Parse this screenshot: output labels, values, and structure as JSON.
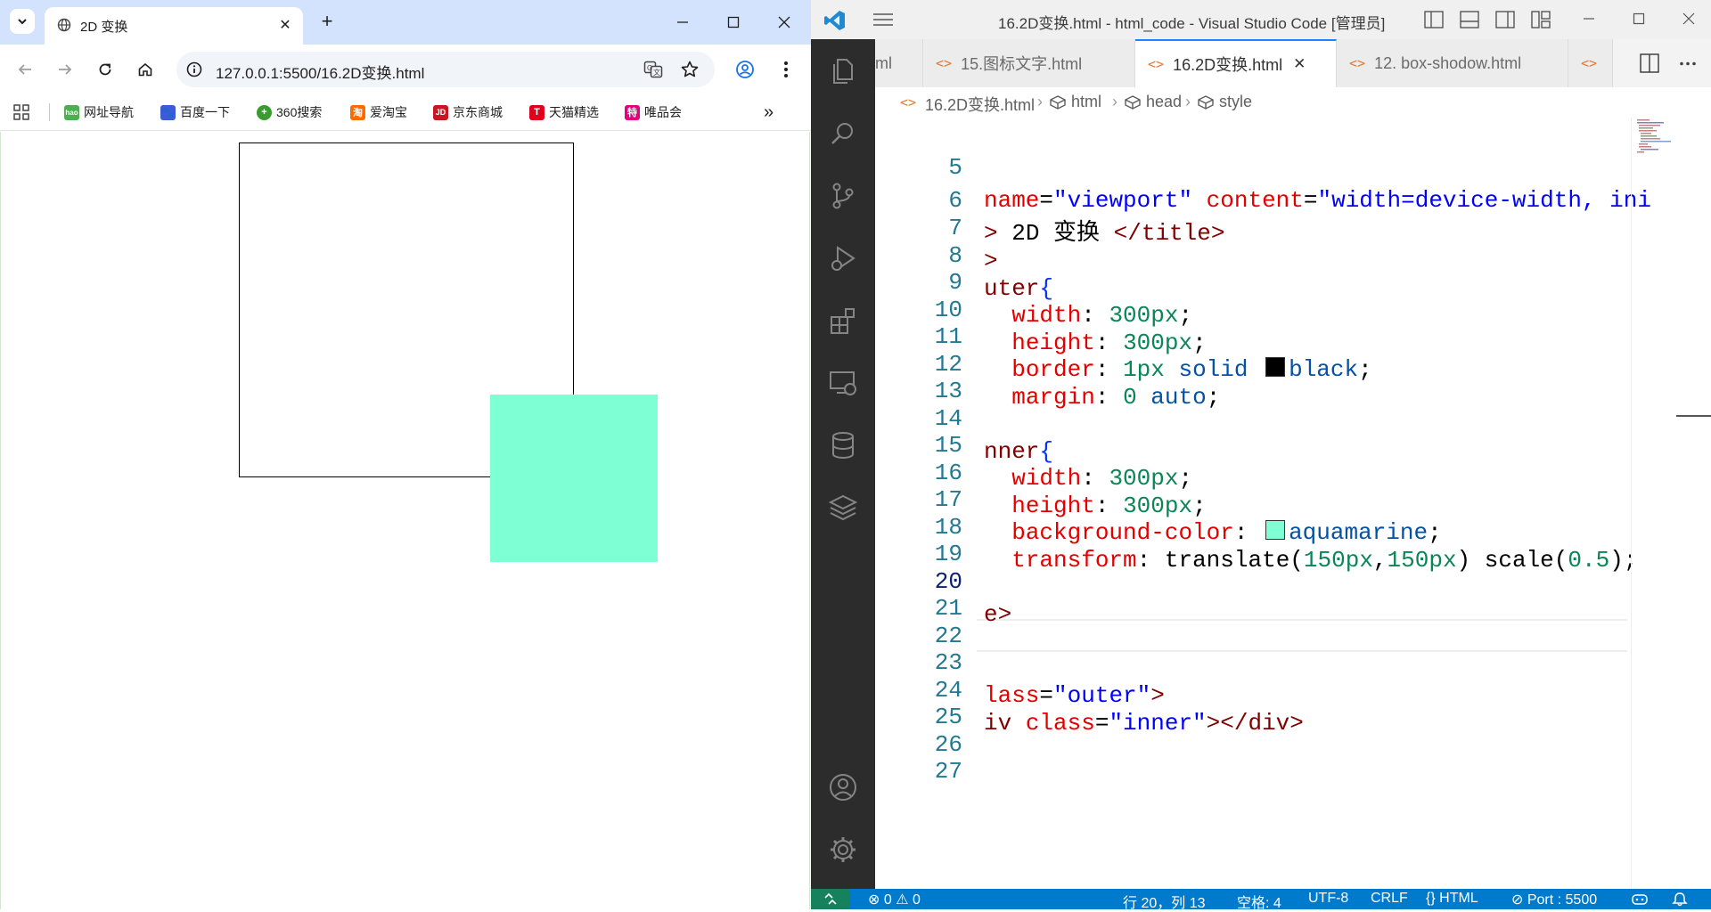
{
  "browser": {
    "tab_title": "2D 变换",
    "url": "127.0.0.1:5500/16.2D变换.html",
    "bookmarks": [
      "网址导航",
      "百度一下",
      "360搜索",
      "爱淘宝",
      "京东商城",
      "天猫精选",
      "唯品会"
    ],
    "bookmark_favicons": [
      "hao",
      "🐾",
      "+",
      "淘",
      "JD",
      "T",
      "特"
    ],
    "bookmark_colors": [
      "#4caf50",
      "#3b5bdb",
      "#3a9c2e",
      "#ff6a00",
      "#c81623",
      "#e1001c",
      "#e4007f"
    ],
    "more_bookmarks": "»",
    "new_tab": "+",
    "tab_close": "✕",
    "page": {
      "outer_border_color": "#000000",
      "inner_color": "#7fffd4"
    }
  },
  "vscode": {
    "window_title": "16.2D变换.html - html_code - Visual Studio Code [管理员]",
    "tabs": [
      {
        "label": "ml",
        "active": false
      },
      {
        "label": "15.图标文字.html",
        "active": false
      },
      {
        "label": "16.2D变换.html",
        "active": true
      },
      {
        "label": "12. box-shodow.html",
        "active": false
      },
      {
        "label": "",
        "active": false
      }
    ],
    "tab_icon": "<>",
    "tab_close": "✕",
    "breadcrumb": [
      "16.2D变换.html",
      "html",
      "head",
      "style"
    ],
    "lines": {
      "n5": "5",
      "n6": "6",
      "n7": "7",
      "n8": "8",
      "n9": "9",
      "n10": "10",
      "n11": "11",
      "n12": "12",
      "n13": "13",
      "n14": "14",
      "n15": "15",
      "n16": "16",
      "n17": "17",
      "n18": "18",
      "n19": "19",
      "n20": "20",
      "n21": "21",
      "n22": "22",
      "n23": "23",
      "n24": "24",
      "n25": "25",
      "n26": "26",
      "n27": "27"
    },
    "code": {
      "l5_attr1": "name",
      "l5_eq1": "=",
      "l5_str1": "\"viewport\"",
      "l5_sp": " ",
      "l5_attr2": "content",
      "l5_eq2": "=",
      "l5_str2": "\"width=device-width, ini",
      "l6_tag1": "> ",
      "l6_text": "2D 变换",
      "l6_tag2": " </title>",
      "l7_tag": ">",
      "l8_sel": "uter",
      "l8_brace": "{",
      "l9_prop": "width",
      "l9_colon": ": ",
      "l9_val": "300px",
      "l9_semi": ";",
      "l10_prop": "height",
      "l10_colon": ": ",
      "l10_val": "300px",
      "l10_semi": ";",
      "l11_prop": "border",
      "l11_colon": ": ",
      "l11_num": "1px",
      "l11_kw": " solid ",
      "l11_color": "black",
      "l11_semi": ";",
      "l12_prop": "margin",
      "l12_colon": ": ",
      "l12_num": "0",
      "l12_kw": " auto",
      "l12_semi": ";",
      "l14_sel": "nner",
      "l14_brace": "{",
      "l15_prop": "width",
      "l15_colon": ": ",
      "l15_val": "300px",
      "l15_semi": ";",
      "l16_prop": "height",
      "l16_colon": ": ",
      "l16_val": "300px",
      "l16_semi": ";",
      "l17_prop": "background-color",
      "l17_colon": ": ",
      "l17_color": "aquamarine",
      "l17_semi": ";",
      "l18_prop": "transform",
      "l18_colon": ": ",
      "l18_fn1": "translate(",
      "l18_n1": "150px",
      "l18_comma": ",",
      "l18_n2": "150px",
      "l18_fn1c": ") ",
      "l18_fn2": "scale(",
      "l18_n3": "0.5",
      "l18_fn2c": ");",
      "l20_tag": "e>",
      "l23_attr": "lass",
      "l23_eq": "=",
      "l23_str": "\"outer\"",
      "l23_tag": ">",
      "l24_tag1": "iv ",
      "l24_attr": "class",
      "l24_eq": "=",
      "l24_str": "\"inner\"",
      "l24_tag2": "></div>"
    },
    "swatch_black": "#000000",
    "swatch_aquamarine": "#7fffd4",
    "status": {
      "errors": "⊗ 0 ⚠ 0",
      "position": "行 20，列 13",
      "spaces": "空格: 4",
      "encoding": "UTF-8",
      "eol": "CRLF",
      "language": "{} HTML",
      "port": "⊘ Port : 5500"
    }
  }
}
